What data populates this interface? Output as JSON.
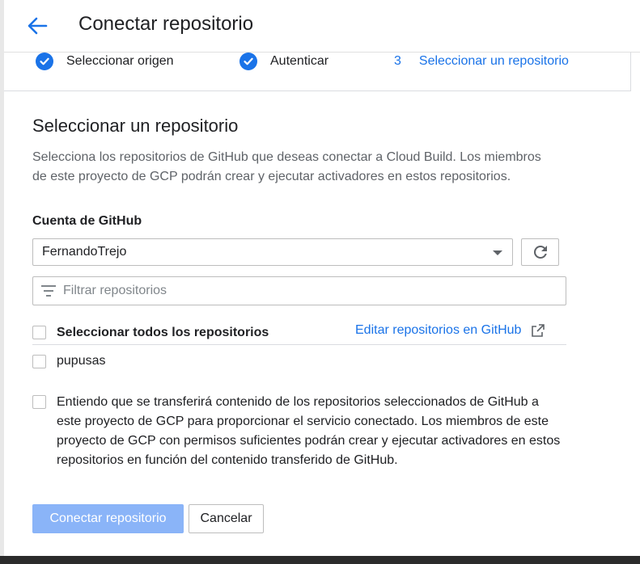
{
  "header": {
    "title": "Conectar repositorio",
    "back_icon": "arrow-back-icon"
  },
  "stepper": {
    "steps": [
      {
        "label": "Seleccionar origen",
        "state": "done"
      },
      {
        "label": "Autenticar",
        "state": "done"
      },
      {
        "number": "3",
        "label": "Seleccionar un repositorio",
        "state": "active"
      }
    ]
  },
  "section": {
    "title": "Seleccionar un repositorio",
    "description": "Selecciona los repositorios de GitHub que deseas conectar a Cloud Build. Los miembros de este proyecto de GCP podrán crear y ejecutar activadores en estos repositorios."
  },
  "account": {
    "label": "Cuenta de GitHub",
    "selected": "FernandoTrejo"
  },
  "filter": {
    "placeholder": "Filtrar repositorios"
  },
  "repos": {
    "select_all_label": "Seleccionar todos los repositorios",
    "edit_link": "Editar repositorios en GitHub",
    "items": [
      {
        "name": "pupusas",
        "checked": false
      }
    ]
  },
  "consent": {
    "text": "Entiendo que se transferirá contenido de los repositorios seleccionados de GitHub a este proyecto de GCP para proporcionar el servicio conectado. Los miembros de este proyecto de GCP con permisos suficientes podrán crear y ejecutar activadores en estos repositorios en función del contenido transferido de GitHub.",
    "checked": false
  },
  "actions": {
    "connect_label": "Conectar repositorio",
    "cancel_label": "Cancelar"
  },
  "colors": {
    "accent": "#1a73e8",
    "primary_disabled": "#8ab4f8"
  }
}
